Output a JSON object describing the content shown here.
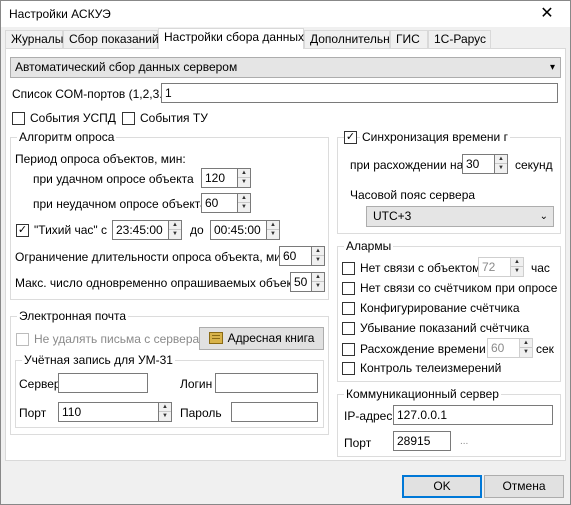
{
  "window": {
    "title": "Настройки АСКУЭ",
    "close_glyph": "✕"
  },
  "tabs": [
    "Журналы",
    "Сбор показаний",
    "Настройки сбора данных",
    "Дополнительно",
    "ГИС",
    "1С-Рарус"
  ],
  "mode_select": {
    "value": "Автоматический сбор данных сервером"
  },
  "com_ports": {
    "label": "Список COM-портов (1,2,3...)",
    "value": "1"
  },
  "events_uspd": {
    "label": "События УСПД",
    "checked": false
  },
  "events_tu": {
    "label": "События ТУ",
    "checked": false
  },
  "algorithm": {
    "title": "Алгоритм опроса",
    "period_label": "Период опроса объектов, мин:",
    "success_label": "при удачном опросе объекта",
    "success_value": "120",
    "fail_label": "при неудачном опросе объекта",
    "fail_value": "60",
    "quiet_label": "\"Тихий час\" с",
    "quiet_checked": true,
    "quiet_from": "23:45:00",
    "quiet_to_label": "до",
    "quiet_to": "00:45:00",
    "limit_label": "Ограничение длительности опроса объекта, мин",
    "limit_value": "60",
    "max_label": "Макс. число одновременно опрашиваемых объектов",
    "max_value": "50"
  },
  "time_sync": {
    "label": "Синхронизация времени г",
    "checked": true,
    "diff_label": "при расхождении на",
    "diff_value": "30",
    "unit": "секунд",
    "tz_label": "Часовой пояс сервера",
    "tz_value": "UTC+3"
  },
  "alarms": {
    "title": "Алармы",
    "no_link": {
      "label": "Нет связи с объектом",
      "value": "72",
      "unit": "час"
    },
    "no_meter": {
      "label": "Нет связи со счётчиком при опросе"
    },
    "config": {
      "label": "Конфигурирование счётчика"
    },
    "decrease": {
      "label": "Убывание показаний счётчика"
    },
    "time_diff": {
      "label": "Расхождение времени >",
      "value": "60",
      "unit": "сек"
    },
    "telemetry": {
      "label": "Контроль телеизмерений"
    }
  },
  "email": {
    "title": "Электронная почта",
    "keep_label": "Не удалять письма с сервера",
    "address_book": "Адресная книга",
    "account_title": "Учётная запись для УМ-31",
    "server_label": "Сервер",
    "server_value": "",
    "login_label": "Логин",
    "login_value": "",
    "port_label": "Порт",
    "port_value": "110",
    "password_label": "Пароль",
    "password_value": ""
  },
  "comm_server": {
    "title": "Коммуникационный сервер",
    "ip_label": "IP-адрес",
    "ip_value": "127.0.0.1",
    "port_label": "Порт",
    "port_value": "28915",
    "port_extra": "..."
  },
  "buttons": {
    "ok": "OK",
    "cancel": "Отмена"
  }
}
